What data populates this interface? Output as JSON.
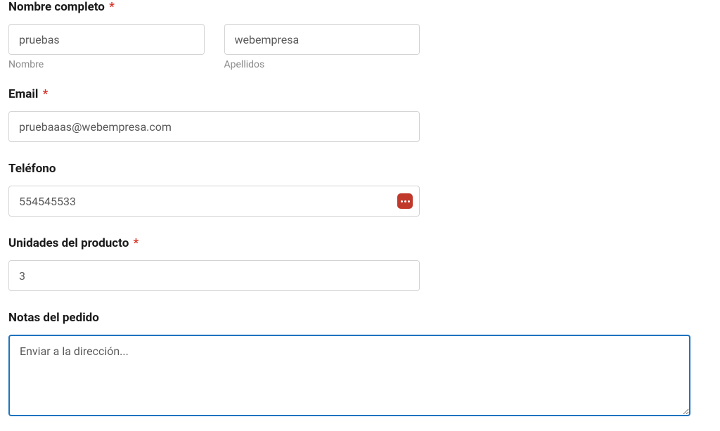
{
  "form": {
    "fullName": {
      "label": "Nombre completo",
      "required": true,
      "firstName": {
        "value": "pruebas",
        "subLabel": "Nombre"
      },
      "lastName": {
        "value": "webempresa",
        "subLabel": "Apellidos"
      }
    },
    "email": {
      "label": "Email",
      "required": true,
      "value": "pruebaaas@webempresa.com"
    },
    "phone": {
      "label": "Teléfono",
      "required": false,
      "value": "554545533"
    },
    "units": {
      "label": "Unidades del producto",
      "required": true,
      "value": "3"
    },
    "notes": {
      "label": "Notas del pedido",
      "required": false,
      "value": "Enviar a la dirección...",
      "placeholder": ""
    }
  },
  "requiredMark": "*"
}
